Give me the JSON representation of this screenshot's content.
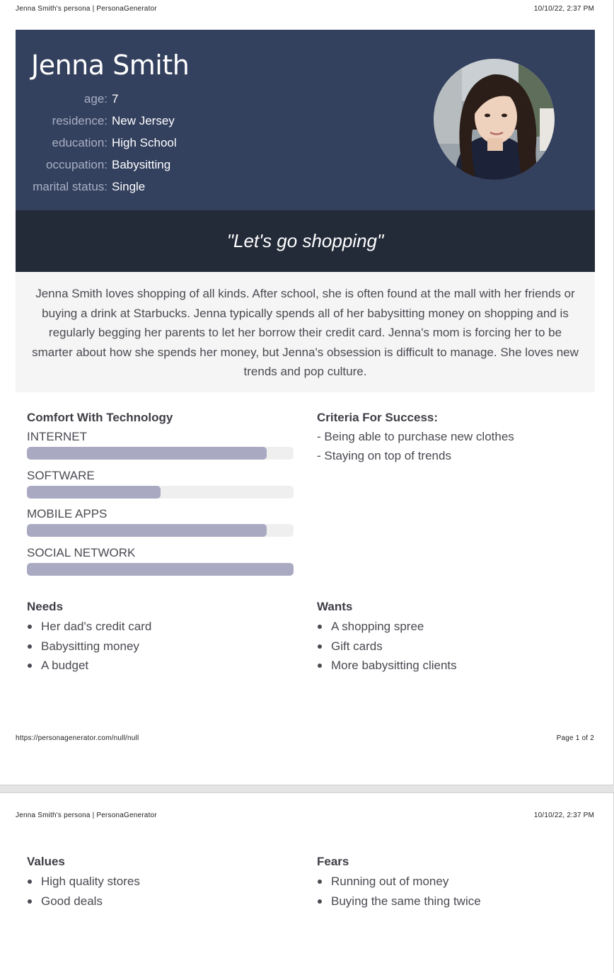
{
  "print_header": {
    "title": "Jenna Smith's persona | PersonaGenerator",
    "datetime": "10/10/22, 2:37 PM"
  },
  "persona": {
    "name": "Jenna Smith",
    "facts": [
      {
        "label": "age:",
        "value": "7"
      },
      {
        "label": "residence:",
        "value": "New Jersey"
      },
      {
        "label": "education:",
        "value": "High School"
      },
      {
        "label": "occupation:",
        "value": "Babysitting"
      },
      {
        "label": "marital status:",
        "value": "Single"
      }
    ],
    "quote": "\"Let's go shopping\"",
    "bio": "Jenna Smith loves shopping of all kinds. After school, she is often found at the mall with her friends or buying a drink at Starbucks. Jenna typically spends all of her babysitting money on shopping and is regularly begging her parents to let her borrow their credit card. Jenna's mom is forcing her to be smarter about how she spends her money, but Jenna's obsession is difficult to manage. She loves new trends and pop culture."
  },
  "comfort": {
    "title": "Comfort With Technology",
    "items": [
      {
        "label": "INTERNET",
        "level": 0.9
      },
      {
        "label": "SOFTWARE",
        "level": 0.5
      },
      {
        "label": "MOBILE APPS",
        "level": 0.9
      },
      {
        "label": "SOCIAL NETWORK",
        "level": 1.0
      }
    ]
  },
  "criteria": {
    "title": "Criteria For Success:",
    "items": [
      "- Being able to purchase new clothes",
      "- Staying on top of trends"
    ]
  },
  "needs": {
    "title": "Needs",
    "items": [
      "Her dad's credit card",
      "Babysitting money",
      "A budget"
    ]
  },
  "wants": {
    "title": "Wants",
    "items": [
      "A shopping spree",
      "Gift cards",
      "More babysitting clients"
    ]
  },
  "footer": {
    "url": "https://personagenerator.com/null/null",
    "page": "Page 1 of 2"
  },
  "values": {
    "title": "Values",
    "items": [
      "High quality stores",
      "Good deals"
    ]
  },
  "fears": {
    "title": "Fears",
    "items": [
      "Running out of money",
      "Buying the same thing twice"
    ]
  },
  "colors": {
    "banner": "#33405e",
    "quote_bg": "#232a38",
    "bar_fill": "#a9a9c2",
    "bar_track": "#efefef"
  }
}
